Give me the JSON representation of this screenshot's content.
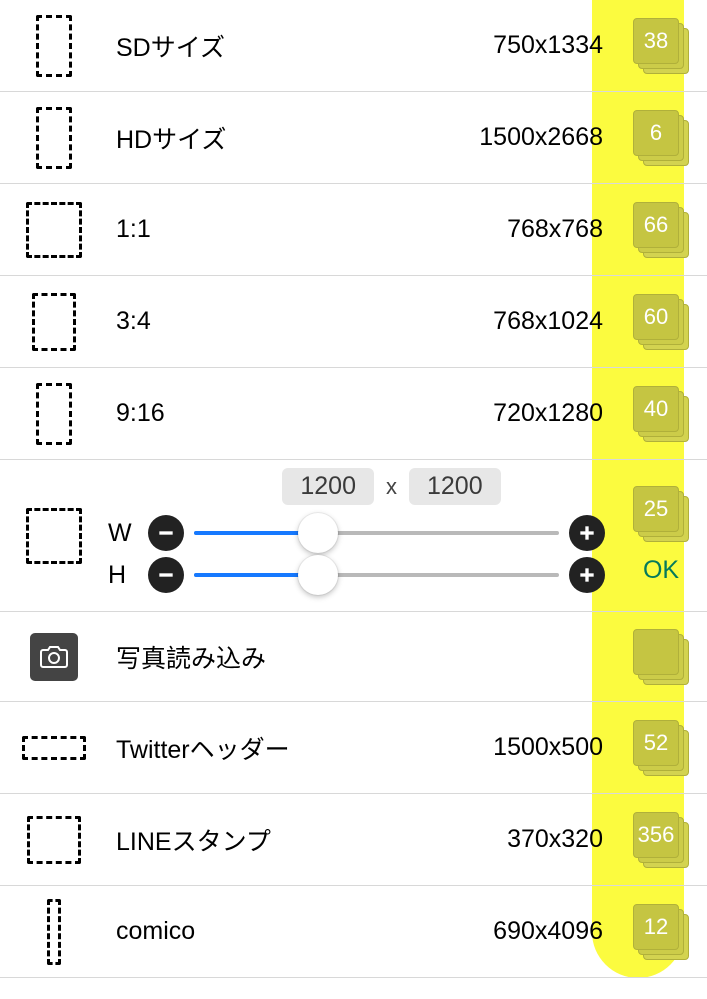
{
  "presets_top": [
    {
      "label": "SDサイズ",
      "dim": "750x1334",
      "badge": "38",
      "iw": 36,
      "ih": 62
    },
    {
      "label": "HDサイズ",
      "dim": "1500x2668",
      "badge": "6",
      "iw": 36,
      "ih": 62
    },
    {
      "label": "1:1",
      "dim": "768x768",
      "badge": "66",
      "iw": 56,
      "ih": 56
    },
    {
      "label": "3:4",
      "dim": "768x1024",
      "badge": "60",
      "iw": 44,
      "ih": 58
    },
    {
      "label": "9:16",
      "dim": "720x1280",
      "badge": "40",
      "iw": 36,
      "ih": 62
    }
  ],
  "custom": {
    "w_label": "W",
    "h_label": "H",
    "sep": "x",
    "w_value": "1200",
    "h_value": "1200",
    "badge": "25",
    "ok": "OK",
    "w_fill_pct": 34,
    "h_fill_pct": 34
  },
  "photo": {
    "label": "写真読み込み"
  },
  "presets_bottom": [
    {
      "label": "Twitterヘッダー",
      "dim": "1500x500",
      "badge": "52",
      "iw": 64,
      "ih": 24
    },
    {
      "label": "LINEスタンプ",
      "dim": "370x320",
      "badge": "356",
      "iw": 54,
      "ih": 48
    },
    {
      "label": "comico",
      "dim": "690x4096",
      "badge": "12",
      "iw": 14,
      "ih": 66
    }
  ]
}
